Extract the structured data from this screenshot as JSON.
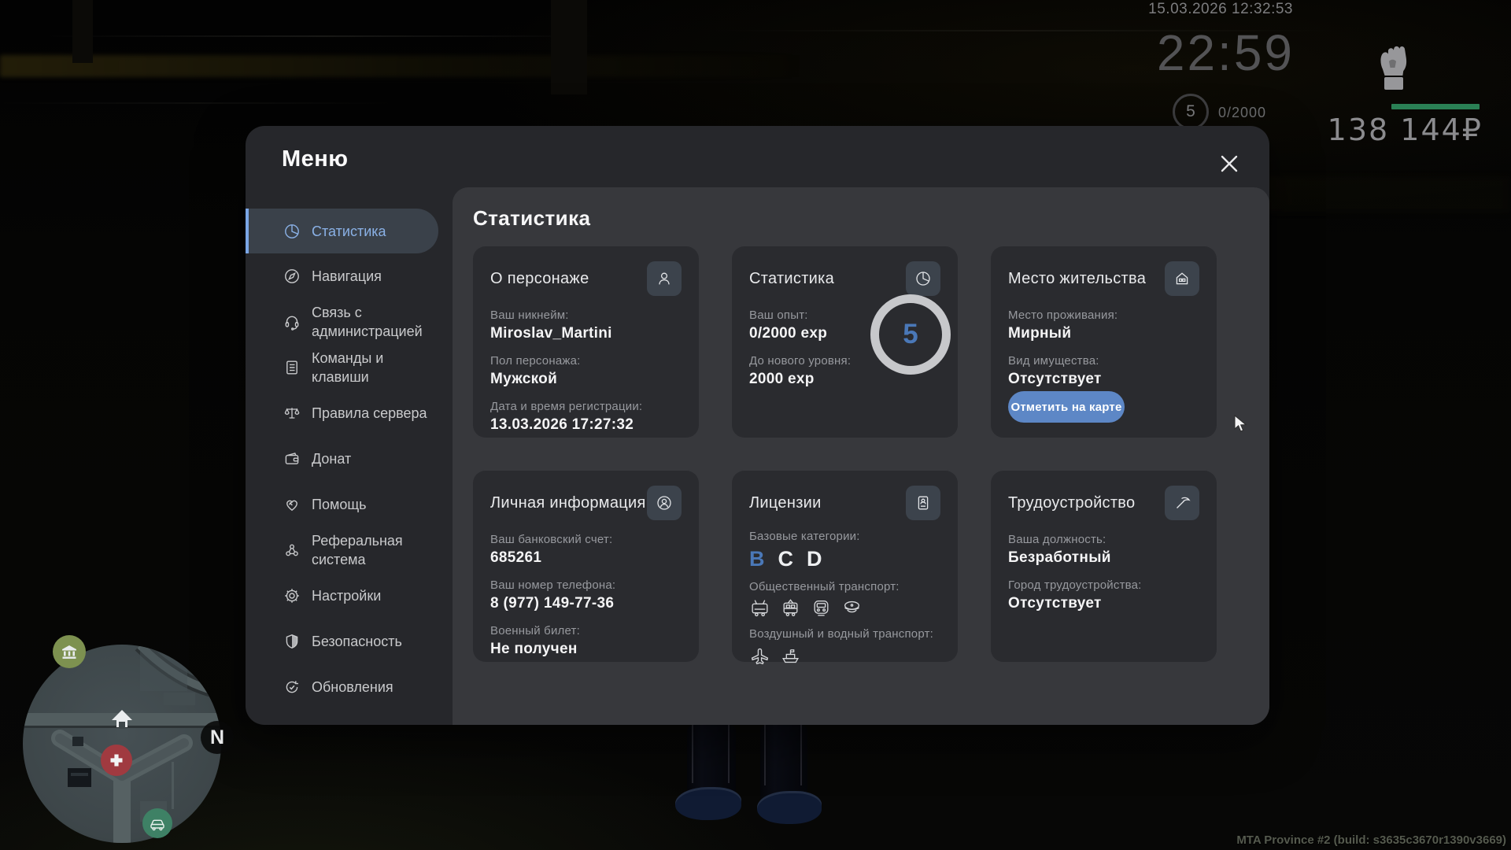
{
  "hud": {
    "datetime": "15.03.2026 12:32:53",
    "clock": "22:59",
    "level": "5",
    "exp": "0/2000",
    "money": "138 144₽",
    "exp_bar_color": "#2a8055"
  },
  "minimap": {
    "compass": "N"
  },
  "menu": {
    "title": "Меню",
    "accent_color": "#7aa6e6",
    "sidebar": [
      {
        "label": "Статистика",
        "icon": "pie-chart",
        "active": true
      },
      {
        "label": "Навигация",
        "icon": "compass"
      },
      {
        "label": "Связь с администрацией",
        "icon": "headset"
      },
      {
        "label": "Команды и клавиши",
        "icon": "commands-doc"
      },
      {
        "label": "Правила сервера",
        "icon": "scales"
      },
      {
        "label": "Донат",
        "icon": "wallet"
      },
      {
        "label": "Помощь",
        "icon": "handshake-heart"
      },
      {
        "label": "Реферальная система",
        "icon": "referral-network"
      },
      {
        "label": "Настройки",
        "icon": "gear"
      },
      {
        "label": "Безопасность",
        "icon": "shield"
      },
      {
        "label": "Обновления",
        "icon": "update-check"
      }
    ],
    "content": {
      "heading": "Статистика",
      "cards": [
        {
          "title": "О персонаже",
          "icon": "person",
          "fields": [
            {
              "label": "Ваш никнейм:",
              "value": "Miroslav_Martini"
            },
            {
              "label": "Пол персонажа:",
              "value": "Мужской"
            },
            {
              "label": "Дата и время регистрации:",
              "value": "13.03.2026 17:27:32"
            }
          ]
        },
        {
          "title": "Статистика",
          "icon": "pie-chart",
          "fields": [
            {
              "label": "Ваш опыт:",
              "value": "0/2000 exp"
            },
            {
              "label": "До нового уровня:",
              "value": "2000 exp"
            }
          ],
          "level_ring": "5",
          "level_color": "#4a78b8"
        },
        {
          "title": "Место жительства",
          "icon": "house",
          "fields": [
            {
              "label": "Место проживания:",
              "value": "Мирный"
            },
            {
              "label": "Вид имущества:",
              "value": "Отсутствует"
            }
          ],
          "button": "Отметить на карте",
          "button_color": "#5d87c6"
        },
        {
          "title": "Личная информация",
          "icon": "person-circle",
          "fields": [
            {
              "label": "Ваш банковский счет:",
              "value": "685261"
            },
            {
              "label": "Ваш номер телефона:",
              "value": "8 (977) 149-77-36"
            },
            {
              "label": "Военный билет:",
              "value": "Не получен"
            }
          ]
        },
        {
          "title": "Лицензии",
          "icon": "license-doc",
          "categories_label": "Базовые категории:",
          "categories": [
            {
              "letter": "B",
              "highlight": true
            },
            {
              "letter": "C",
              "highlight": false
            },
            {
              "letter": "D",
              "highlight": false
            }
          ],
          "public_transport_label": "Общественный транспорт:",
          "public_transport_icons": [
            "trolleybus",
            "tram",
            "metro",
            "conductor-cap"
          ],
          "air_water_label": "Воздушный и водный транспорт:",
          "air_water_icons": [
            "airplane",
            "ship"
          ]
        },
        {
          "title": "Трудоустройство",
          "icon": "pickaxe",
          "fields": [
            {
              "label": "Ваша должность:",
              "value": "Безработный"
            },
            {
              "label": "Город трудоустройства:",
              "value": "Отсутствует"
            }
          ]
        }
      ]
    }
  },
  "build_label": "MTA Province #2 (build: s3635c3670r1390v3669)"
}
